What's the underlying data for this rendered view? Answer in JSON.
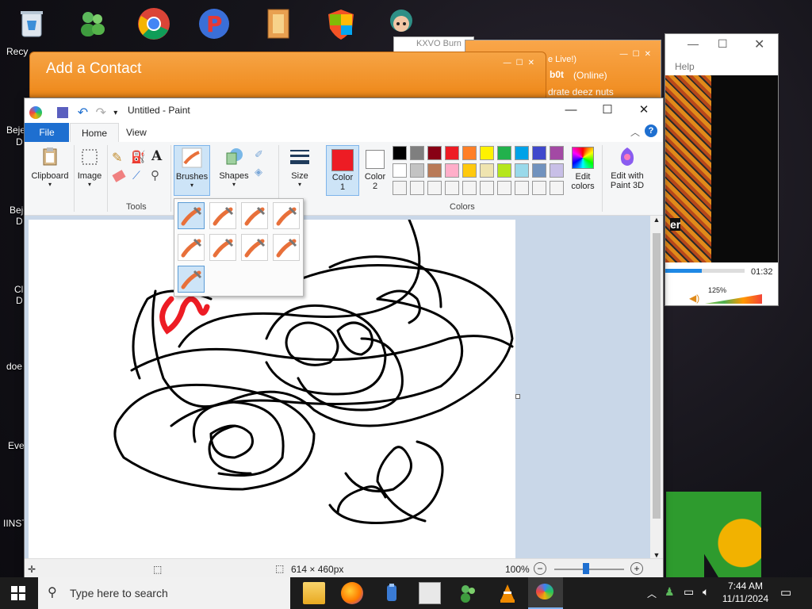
{
  "desktop": {
    "labels": [
      "Recy",
      "Beje",
      "D",
      "Beje",
      "D",
      "Cl",
      "D",
      "doe",
      "Eve",
      "IINST"
    ]
  },
  "bg_windows": {
    "kxvo_title": "KXVO Burn",
    "chat_live": "e Live!)",
    "chat_user": "b0t",
    "chat_status": "(Online)",
    "chat_message": "drate deez nuts",
    "player_help": "Help",
    "player_time": "01:32",
    "player_volume": "125%",
    "player_brand": "er"
  },
  "add_contact": {
    "title": "Add a Contact"
  },
  "paint": {
    "window_title": "Untitled - Paint",
    "tabs": {
      "file": "File",
      "home": "Home",
      "view": "View"
    },
    "ribbon": {
      "clipboard": "Clipboard",
      "image": "Image",
      "tools_group": "Tools",
      "brushes": "Brushes",
      "shapes": "Shapes",
      "size": "Size",
      "color1": "Color\n1",
      "color1_a": "Color",
      "color1_b": "1",
      "color2_a": "Color",
      "color2_b": "2",
      "colors_group": "Colors",
      "edit_colors_a": "Edit",
      "edit_colors_b": "colors",
      "paint3d_a": "Edit with",
      "paint3d_b": "Paint 3D"
    },
    "colors": {
      "color1": "#ed1c24",
      "color2": "#ffffff",
      "palette_row1": [
        "#000000",
        "#7f7f7f",
        "#880015",
        "#ed1c24",
        "#ff7f27",
        "#fff200",
        "#22b14c",
        "#00a2e8",
        "#3f48cc",
        "#a349a4"
      ],
      "palette_row2": [
        "#ffffff",
        "#c3c3c3",
        "#b97a57",
        "#ffaec9",
        "#ffc90e",
        "#efe4b0",
        "#b5e61d",
        "#99d9ea",
        "#7092be",
        "#c8bfe7"
      ],
      "palette_row3": [
        "#f4f4f4",
        "#f4f4f4",
        "#f4f4f4",
        "#f4f4f4",
        "#f4f4f4",
        "#f4f4f4",
        "#f4f4f4",
        "#f4f4f4",
        "#f4f4f4",
        "#f4f4f4"
      ]
    },
    "status": {
      "canvas_size": "614 × 460px",
      "zoom": "100%"
    }
  },
  "taskbar": {
    "search_placeholder": "Type here to search",
    "time": "7:44 AM",
    "date": "11/11/2024"
  }
}
